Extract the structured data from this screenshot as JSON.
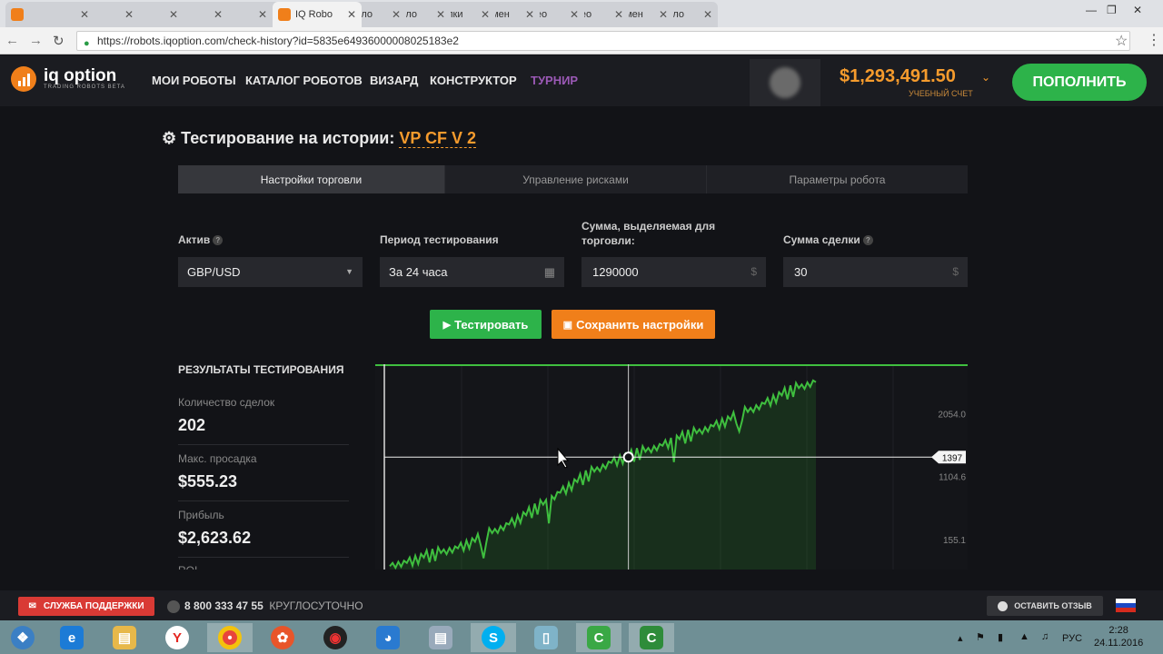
{
  "browser": {
    "tabs": [
      {
        "title": "",
        "color": "#f07f1a"
      },
      {
        "title": "",
        "color": "#f07f1a"
      },
      {
        "title": "",
        "color": "#d44638"
      },
      {
        "title": "",
        "color": "#f4b400"
      },
      {
        "title": "",
        "color": "#e62117"
      },
      {
        "title": "",
        "color": "#e62117"
      },
      {
        "title": "IQ Robo",
        "color": "#f07f1a",
        "active": true
      },
      {
        "title": "Катало",
        "color": "#f07f1a"
      },
      {
        "title": "Катало",
        "color": "#f07f1a"
      },
      {
        "title": "Сделки",
        "color": "#f07f1a"
      },
      {
        "title": "Коммен",
        "color": "#e62117"
      },
      {
        "title": "Видео",
        "color": "#e62117"
      },
      {
        "title": "Видео",
        "color": "#e62117"
      },
      {
        "title": "Коммен",
        "color": "#e62117"
      },
      {
        "title": "Катало",
        "color": "#f07f1a"
      }
    ],
    "url": "https://robots.iqoption.com/check-history?id=5835e64936000008025183e2"
  },
  "header": {
    "logo_main": "iq option",
    "logo_sub": "TRADING ROBOTS BETA",
    "menu": [
      "МОИ РОБОТЫ",
      "КАТАЛОГ РОБОТОВ",
      "ВИЗАРД",
      "КОНСТРУКТОР",
      "ТУРНИР"
    ],
    "balance": "$1,293,491.50",
    "balance_label": "УЧЕБНЫЙ СЧЕТ",
    "deposit": "ПОПОЛНИТЬ"
  },
  "page": {
    "title": "Тестирование на истории:",
    "robot_name": "VP CF V 2",
    "tabs": [
      "Настройки торговли",
      "Управление рисками",
      "Параметры робота"
    ],
    "fields": {
      "asset_label": "Актив",
      "asset_value": "GBP/USD",
      "period_label": "Период тестирования",
      "period_value": "За 24 часа",
      "amount_label_1": "Сумма, выделяемая для",
      "amount_label_2": "торговли:",
      "amount_value": "1290000",
      "deal_label": "Сумма сделки",
      "deal_value": "30",
      "currency": "$"
    },
    "buttons": {
      "test": "Тестировать",
      "save": "Сохранить настройки"
    }
  },
  "results": {
    "title": "РЕЗУЛЬТАТЫ ТЕСТИРОВАНИЯ",
    "stats": [
      {
        "label": "Количество сделок",
        "value": "202"
      },
      {
        "label": "Макс. просадка",
        "value": "$555.23"
      },
      {
        "label": "Прибыль",
        "value": "$2,623.62"
      },
      {
        "label": "ROI",
        "value": ""
      }
    ]
  },
  "chart_data": {
    "type": "area",
    "y_ticks": [
      "2054.0",
      "1104.6",
      "155.1"
    ],
    "y_tick_values": [
      2054.0,
      1104.6,
      155.1
    ],
    "crosshair_label": "1397",
    "crosshair_value": 1397,
    "color": "#3fbf3f",
    "approx_series": [
      -250,
      -200,
      -120,
      -50,
      20,
      120,
      250,
      380,
      520,
      680,
      860,
      1020,
      1180,
      1310,
      1397,
      1480,
      1570,
      1670,
      1760,
      1860,
      1960,
      2080,
      2200,
      2330,
      2440,
      2530
    ],
    "ylim": [
      -300,
      2800
    ]
  },
  "footer": {
    "support": "СЛУЖБА ПОДДЕРЖКИ",
    "phone": "8 800 333 47 55",
    "hours": "КРУГЛОСУТОЧНО",
    "feedback": "ОСТАВИТЬ ОТЗЫВ"
  },
  "taskbar": {
    "lang": "РУС",
    "time": "2:28",
    "date": "24.11.2016"
  }
}
